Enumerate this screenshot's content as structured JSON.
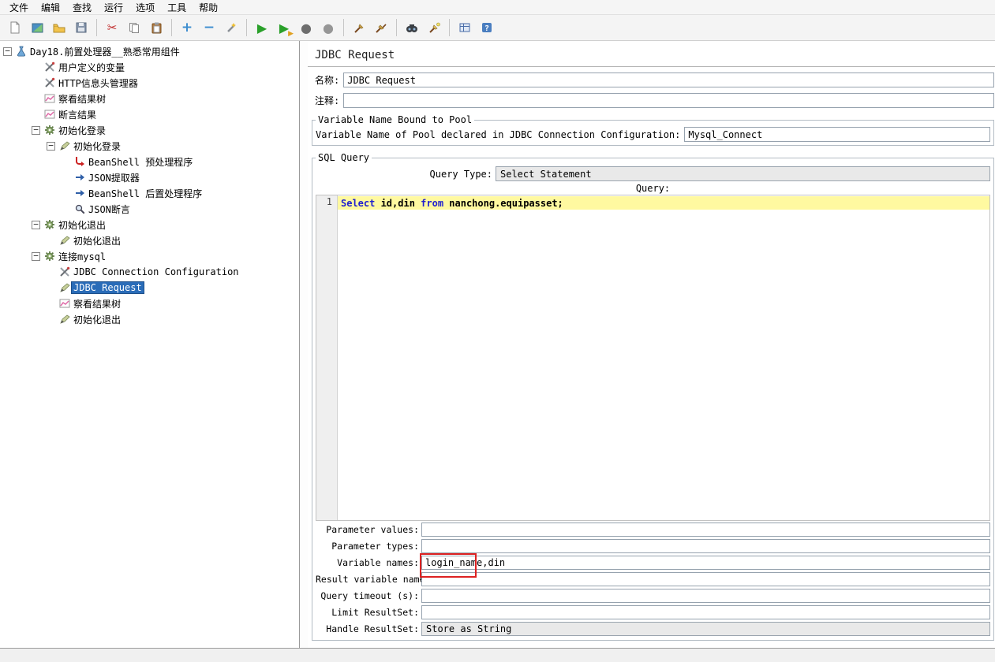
{
  "menu": {
    "items": [
      "文件",
      "编辑",
      "查找",
      "运行",
      "选项",
      "工具",
      "帮助"
    ]
  },
  "toolbar": {
    "icons": [
      "new",
      "templates",
      "open",
      "save",
      "cut",
      "copy",
      "paste",
      "expand-all",
      "collapse-all",
      "toggle",
      "start",
      "start-no-pauses",
      "stop",
      "shutdown",
      "clear",
      "clear-all",
      "search",
      "reset-search",
      "function-helper",
      "help"
    ]
  },
  "tree": {
    "items": [
      {
        "label": "Day18.前置处理器__熟悉常用组件"
      },
      {
        "label": "用户定义的变量"
      },
      {
        "label": "HTTP信息头管理器"
      },
      {
        "label": "察看结果树"
      },
      {
        "label": "断言结果"
      },
      {
        "label": "初始化登录"
      },
      {
        "label": "初始化登录"
      },
      {
        "label": "BeanShell 预处理程序"
      },
      {
        "label": "JSON提取器"
      },
      {
        "label": "BeanShell 后置处理程序"
      },
      {
        "label": "JSON断言"
      },
      {
        "label": "初始化退出"
      },
      {
        "label": "初始化退出"
      },
      {
        "label": "连接mysql"
      },
      {
        "label": "JDBC Connection Configuration"
      },
      {
        "label": "JDBC Request",
        "selected": true
      },
      {
        "label": "察看结果树"
      },
      {
        "label": "初始化退出"
      }
    ]
  },
  "panel": {
    "title": "JDBC Request",
    "name_label": "名称:",
    "name_value": "JDBC Request",
    "comment_label": "注释:",
    "comment_value": "",
    "pool": {
      "legend": "Variable Name Bound to Pool",
      "label": "Variable Name of Pool declared in JDBC Connection Configuration:",
      "value": "Mysql_Connect"
    },
    "sql": {
      "legend": "SQL Query",
      "query_type_label": "Query Type:",
      "query_type_value": "Select Statement",
      "query_label": "Query:",
      "line_number": "1",
      "tokens": [
        {
          "text": "Select"
        },
        {
          "text": " id,din "
        },
        {
          "text": "from"
        },
        {
          "text": " nanchong.equipasset;"
        }
      ],
      "rows": [
        {
          "label": "Parameter values:",
          "value": ""
        },
        {
          "label": "Parameter types:",
          "value": ""
        },
        {
          "label": "Variable names:",
          "value": "login_name,din"
        },
        {
          "label": "Result variable name:",
          "value": ""
        },
        {
          "label": "Query timeout (s):",
          "value": ""
        },
        {
          "label": "Limit ResultSet:",
          "value": ""
        },
        {
          "label": "Handle ResultSet:",
          "value": "Store as String"
        }
      ]
    }
  },
  "colors": {
    "selection": "#2a6cb8",
    "keyword": "#1f1fd0",
    "line_highlight": "#fff9a0",
    "annotation": "#dd2222",
    "combo_bg": "#e9e9e9"
  }
}
